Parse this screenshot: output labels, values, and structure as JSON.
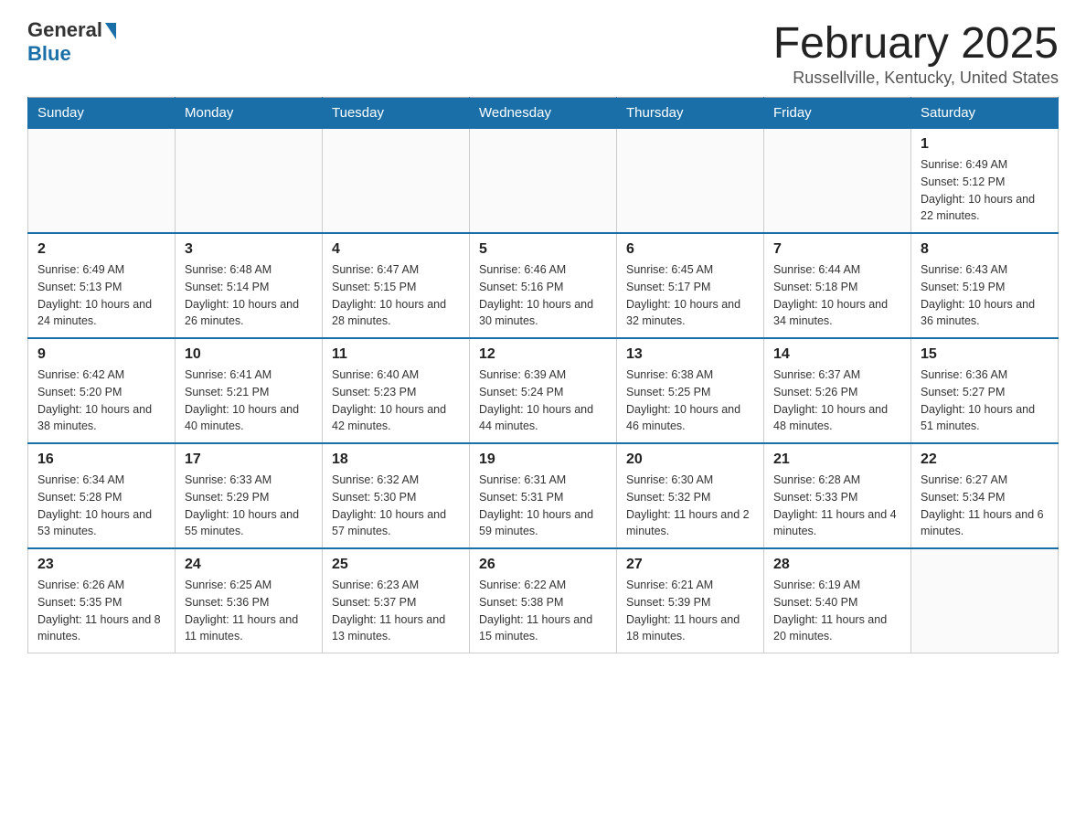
{
  "header": {
    "logo_general": "General",
    "logo_blue": "Blue",
    "title": "February 2025",
    "subtitle": "Russellville, Kentucky, United States"
  },
  "weekdays": [
    "Sunday",
    "Monday",
    "Tuesday",
    "Wednesday",
    "Thursday",
    "Friday",
    "Saturday"
  ],
  "weeks": [
    [
      {
        "day": "",
        "info": ""
      },
      {
        "day": "",
        "info": ""
      },
      {
        "day": "",
        "info": ""
      },
      {
        "day": "",
        "info": ""
      },
      {
        "day": "",
        "info": ""
      },
      {
        "day": "",
        "info": ""
      },
      {
        "day": "1",
        "info": "Sunrise: 6:49 AM\nSunset: 5:12 PM\nDaylight: 10 hours and 22 minutes."
      }
    ],
    [
      {
        "day": "2",
        "info": "Sunrise: 6:49 AM\nSunset: 5:13 PM\nDaylight: 10 hours and 24 minutes."
      },
      {
        "day": "3",
        "info": "Sunrise: 6:48 AM\nSunset: 5:14 PM\nDaylight: 10 hours and 26 minutes."
      },
      {
        "day": "4",
        "info": "Sunrise: 6:47 AM\nSunset: 5:15 PM\nDaylight: 10 hours and 28 minutes."
      },
      {
        "day": "5",
        "info": "Sunrise: 6:46 AM\nSunset: 5:16 PM\nDaylight: 10 hours and 30 minutes."
      },
      {
        "day": "6",
        "info": "Sunrise: 6:45 AM\nSunset: 5:17 PM\nDaylight: 10 hours and 32 minutes."
      },
      {
        "day": "7",
        "info": "Sunrise: 6:44 AM\nSunset: 5:18 PM\nDaylight: 10 hours and 34 minutes."
      },
      {
        "day": "8",
        "info": "Sunrise: 6:43 AM\nSunset: 5:19 PM\nDaylight: 10 hours and 36 minutes."
      }
    ],
    [
      {
        "day": "9",
        "info": "Sunrise: 6:42 AM\nSunset: 5:20 PM\nDaylight: 10 hours and 38 minutes."
      },
      {
        "day": "10",
        "info": "Sunrise: 6:41 AM\nSunset: 5:21 PM\nDaylight: 10 hours and 40 minutes."
      },
      {
        "day": "11",
        "info": "Sunrise: 6:40 AM\nSunset: 5:23 PM\nDaylight: 10 hours and 42 minutes."
      },
      {
        "day": "12",
        "info": "Sunrise: 6:39 AM\nSunset: 5:24 PM\nDaylight: 10 hours and 44 minutes."
      },
      {
        "day": "13",
        "info": "Sunrise: 6:38 AM\nSunset: 5:25 PM\nDaylight: 10 hours and 46 minutes."
      },
      {
        "day": "14",
        "info": "Sunrise: 6:37 AM\nSunset: 5:26 PM\nDaylight: 10 hours and 48 minutes."
      },
      {
        "day": "15",
        "info": "Sunrise: 6:36 AM\nSunset: 5:27 PM\nDaylight: 10 hours and 51 minutes."
      }
    ],
    [
      {
        "day": "16",
        "info": "Sunrise: 6:34 AM\nSunset: 5:28 PM\nDaylight: 10 hours and 53 minutes."
      },
      {
        "day": "17",
        "info": "Sunrise: 6:33 AM\nSunset: 5:29 PM\nDaylight: 10 hours and 55 minutes."
      },
      {
        "day": "18",
        "info": "Sunrise: 6:32 AM\nSunset: 5:30 PM\nDaylight: 10 hours and 57 minutes."
      },
      {
        "day": "19",
        "info": "Sunrise: 6:31 AM\nSunset: 5:31 PM\nDaylight: 10 hours and 59 minutes."
      },
      {
        "day": "20",
        "info": "Sunrise: 6:30 AM\nSunset: 5:32 PM\nDaylight: 11 hours and 2 minutes."
      },
      {
        "day": "21",
        "info": "Sunrise: 6:28 AM\nSunset: 5:33 PM\nDaylight: 11 hours and 4 minutes."
      },
      {
        "day": "22",
        "info": "Sunrise: 6:27 AM\nSunset: 5:34 PM\nDaylight: 11 hours and 6 minutes."
      }
    ],
    [
      {
        "day": "23",
        "info": "Sunrise: 6:26 AM\nSunset: 5:35 PM\nDaylight: 11 hours and 8 minutes."
      },
      {
        "day": "24",
        "info": "Sunrise: 6:25 AM\nSunset: 5:36 PM\nDaylight: 11 hours and 11 minutes."
      },
      {
        "day": "25",
        "info": "Sunrise: 6:23 AM\nSunset: 5:37 PM\nDaylight: 11 hours and 13 minutes."
      },
      {
        "day": "26",
        "info": "Sunrise: 6:22 AM\nSunset: 5:38 PM\nDaylight: 11 hours and 15 minutes."
      },
      {
        "day": "27",
        "info": "Sunrise: 6:21 AM\nSunset: 5:39 PM\nDaylight: 11 hours and 18 minutes."
      },
      {
        "day": "28",
        "info": "Sunrise: 6:19 AM\nSunset: 5:40 PM\nDaylight: 11 hours and 20 minutes."
      },
      {
        "day": "",
        "info": ""
      }
    ]
  ]
}
